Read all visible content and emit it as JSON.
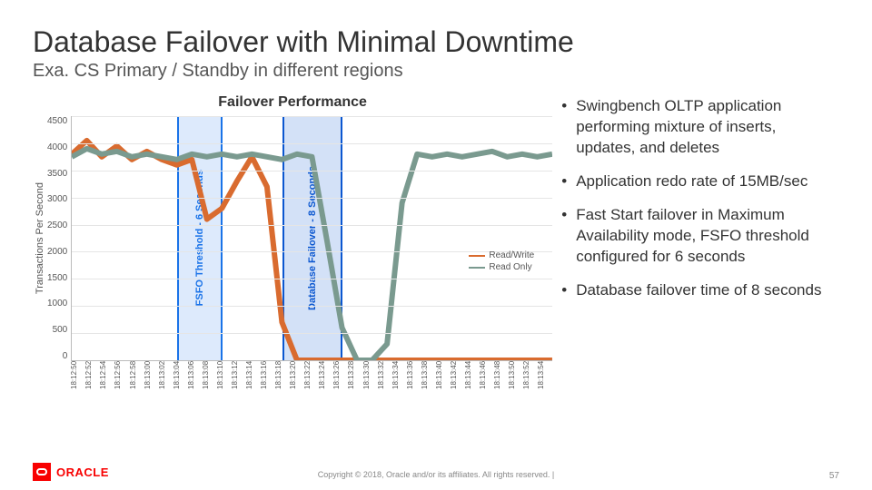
{
  "title": "Database Failover with Minimal Downtime",
  "subtitle": "Exa. CS Primary / Standby in different regions",
  "bullets": [
    "Swingbench OLTP application performing mixture of inserts, updates, and deletes",
    "Application redo rate of 15MB/sec",
    "Fast Start failover in Maximum Availability mode, FSFO threshold configured for 6 seconds",
    "Database failover time of 8 seconds"
  ],
  "legend": {
    "rw": {
      "label": "Read/Write",
      "color": "#d96b2f"
    },
    "ro": {
      "label": "Read Only",
      "color": "#7a9a8f"
    }
  },
  "bands": {
    "fsfo": {
      "label": "FSFO Threshold - 6 Seconds"
    },
    "db": {
      "label": "Database Failover - 8 Seconds"
    }
  },
  "footer": {
    "logo": "ORACLE",
    "copyright": "Copyright © 2018, Oracle and/or its affiliates. All rights reserved. |",
    "page": "57"
  },
  "chart_data": {
    "type": "line",
    "title": "Failover Performance",
    "ylabel": "Transactions Per Second",
    "xlabel": "",
    "ylim": [
      0,
      4500
    ],
    "yticks": [
      0,
      500,
      1000,
      1500,
      2000,
      2500,
      3000,
      3500,
      4000,
      4500
    ],
    "x": [
      "18:12:50",
      "18:12:52",
      "18:12:54",
      "18:12:56",
      "18:12:58",
      "18:13:00",
      "18:13:02",
      "18:13:04",
      "18:13:06",
      "18:13:08",
      "18:13:10",
      "18:13:12",
      "18:13:14",
      "18:13:16",
      "18:13:18",
      "18:13:20",
      "18:13:22",
      "18:13:24",
      "18:13:26",
      "18:13:28",
      "18:13:30",
      "18:13:32",
      "18:13:34",
      "18:13:36",
      "18:13:38",
      "18:13:40",
      "18:13:42",
      "18:13:44",
      "18:13:46",
      "18:13:48",
      "18:13:50",
      "18:13:52",
      "18:13:54"
    ],
    "series": [
      {
        "name": "Read/Write",
        "color": "#d96b2f",
        "values": [
          3800,
          4050,
          3750,
          3950,
          3700,
          3850,
          3700,
          3600,
          3700,
          2600,
          2800,
          3300,
          3750,
          3200,
          700,
          0,
          0,
          0,
          0,
          0,
          0,
          0,
          0,
          0,
          0,
          0,
          0,
          0,
          0,
          0,
          0,
          0,
          0
        ]
      },
      {
        "name": "Read Only",
        "color": "#7a9a8f",
        "values": [
          3750,
          3900,
          3800,
          3850,
          3750,
          3800,
          3750,
          3700,
          3800,
          3750,
          3800,
          3750,
          3800,
          3750,
          3700,
          3800,
          3750,
          2200,
          600,
          0,
          0,
          300,
          2900,
          3800,
          3750,
          3800,
          3750,
          3800,
          3850,
          3750,
          3800,
          3750,
          3800
        ]
      }
    ],
    "annotations": {
      "fsfo_band": {
        "from": "18:13:04",
        "to": "18:13:10"
      },
      "db_band": {
        "from": "18:13:18",
        "to": "18:13:26"
      }
    }
  }
}
